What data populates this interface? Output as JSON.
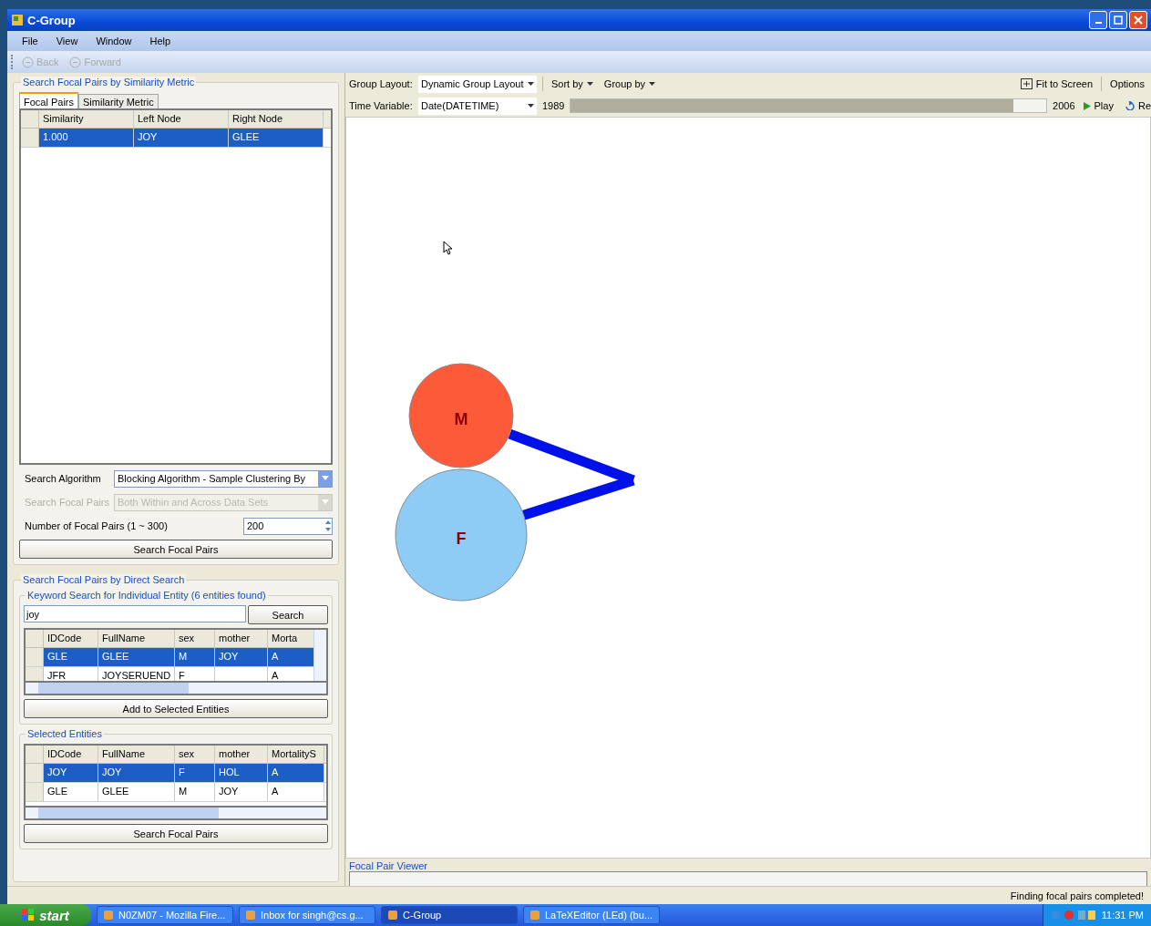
{
  "window": {
    "title": "C-Group"
  },
  "menu": [
    "File",
    "View",
    "Window",
    "Help"
  ],
  "toolbar": [
    {
      "label": "Back",
      "disabled": true
    },
    {
      "label": "Forward",
      "disabled": true
    }
  ],
  "similarity_search": {
    "title": "Search Focal Pairs by Similarity Metric",
    "tabs": [
      {
        "label": "Focal Pairs",
        "selected": true
      },
      {
        "label": "Similarity Metric",
        "selected": false
      }
    ],
    "table": {
      "columns": [
        "Similarity",
        "Left Node",
        "Right Node"
      ],
      "rows": [
        {
          "cells": [
            "1.000",
            "JOY",
            "GLEE"
          ],
          "selected": true
        }
      ]
    },
    "algorithm": {
      "label": "Search Algorithm",
      "value": "Blocking Algorithm - Sample Clustering By"
    },
    "scope": {
      "label": "Search Focal Pairs",
      "value": "Both Within and Across Data Sets",
      "disabled": true
    },
    "count": {
      "label": "Number of Focal Pairs (1 ~ 300)",
      "value": "200"
    },
    "button": "Search Focal Pairs"
  },
  "direct_search": {
    "title": "Search Focal Pairs by Direct Search",
    "keyword": {
      "title": "Keyword Search for Individual Entity (6 entities found)",
      "value": "joy",
      "button": "Search"
    },
    "results": {
      "columns": [
        "IDCode",
        "FullName",
        "sex",
        "mother",
        "Morta"
      ],
      "rows": [
        {
          "cells": [
            "GLE",
            "GLEE",
            "M",
            "JOY",
            "A"
          ],
          "selected": true
        },
        {
          "cells": [
            "JFR",
            "JOYSERUEND",
            "F",
            null,
            "A"
          ],
          "selected": false
        }
      ]
    },
    "add_button": "Add to Selected Entities",
    "selected_entities": {
      "title": "Selected Entities",
      "columns": [
        "IDCode",
        "FullName",
        "sex",
        "mother",
        "MortalityS"
      ],
      "rows": [
        {
          "cells": [
            "JOY",
            "JOY",
            "F",
            "HOL",
            "A"
          ],
          "selected": true
        },
        {
          "cells": [
            "GLE",
            "GLEE",
            "M",
            "JOY",
            "A"
          ],
          "selected": false
        }
      ]
    },
    "button": "Search Focal Pairs"
  },
  "graph": {
    "group_layout": {
      "label": "Group Layout:",
      "value": "Dynamic Group Layout"
    },
    "sort_by": "Sort by",
    "group_by": "Group by",
    "fit": "Fit to Screen",
    "options": "Options",
    "time_variable": {
      "label": "Time Variable:",
      "value": "Date(DATETIME)"
    },
    "time_start": "1989",
    "time_end": "2006",
    "level": 0.93,
    "play": "Play",
    "reset": "Re",
    "nodes": [
      {
        "label": "M",
        "color": "#fd5a3a"
      },
      {
        "label": "F",
        "color": "#8ecbf5"
      }
    ]
  },
  "viewer": {
    "title": "Focal Pair Viewer"
  },
  "status_bar": "Finding focal pairs completed!",
  "taskbar": {
    "start": "start",
    "tasks": [
      {
        "label": "N0ZM07 - Mozilla Fire...",
        "selected": false
      },
      {
        "label": "Inbox for singh@cs.g...",
        "selected": false
      },
      {
        "label": "C-Group",
        "selected": true
      },
      {
        "label": "LaTeXEditor (LEd) (bu...",
        "selected": false
      }
    ],
    "clock": "11:31 PM"
  }
}
